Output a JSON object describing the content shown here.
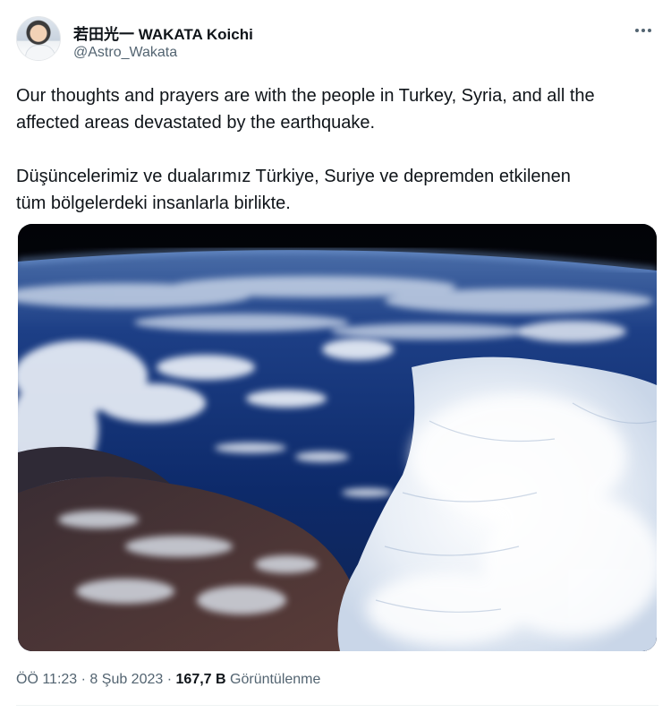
{
  "author": {
    "display_name": "若田光一 WAKATA Koichi",
    "handle": "@Astro_Wakata",
    "avatar_icon": "astronaut-portrait"
  },
  "tweet": {
    "text_en": [
      "Our thoughts and prayers are with the people in Turkey, Syria, and all the",
      "affected areas devastated by the earthquake."
    ],
    "text_tr": [
      "Düşüncelerimiz ve dualarımız Türkiye, Suriye ve depremden etkilenen",
      "tüm bölgelerdeki insanlarla birlikte."
    ]
  },
  "media": {
    "icon": "earth-from-orbit-photo"
  },
  "meta": {
    "time": "ÖÖ 11:23",
    "separator": "·",
    "date": "8 Şub 2023",
    "views_count": "167,7 B",
    "views_label": "Görüntülenme"
  },
  "colors": {
    "text": "#0f1419",
    "secondary": "#536471",
    "divider": "#eff3f4",
    "ocean": "#0c2a6b",
    "space": "#05070d"
  }
}
